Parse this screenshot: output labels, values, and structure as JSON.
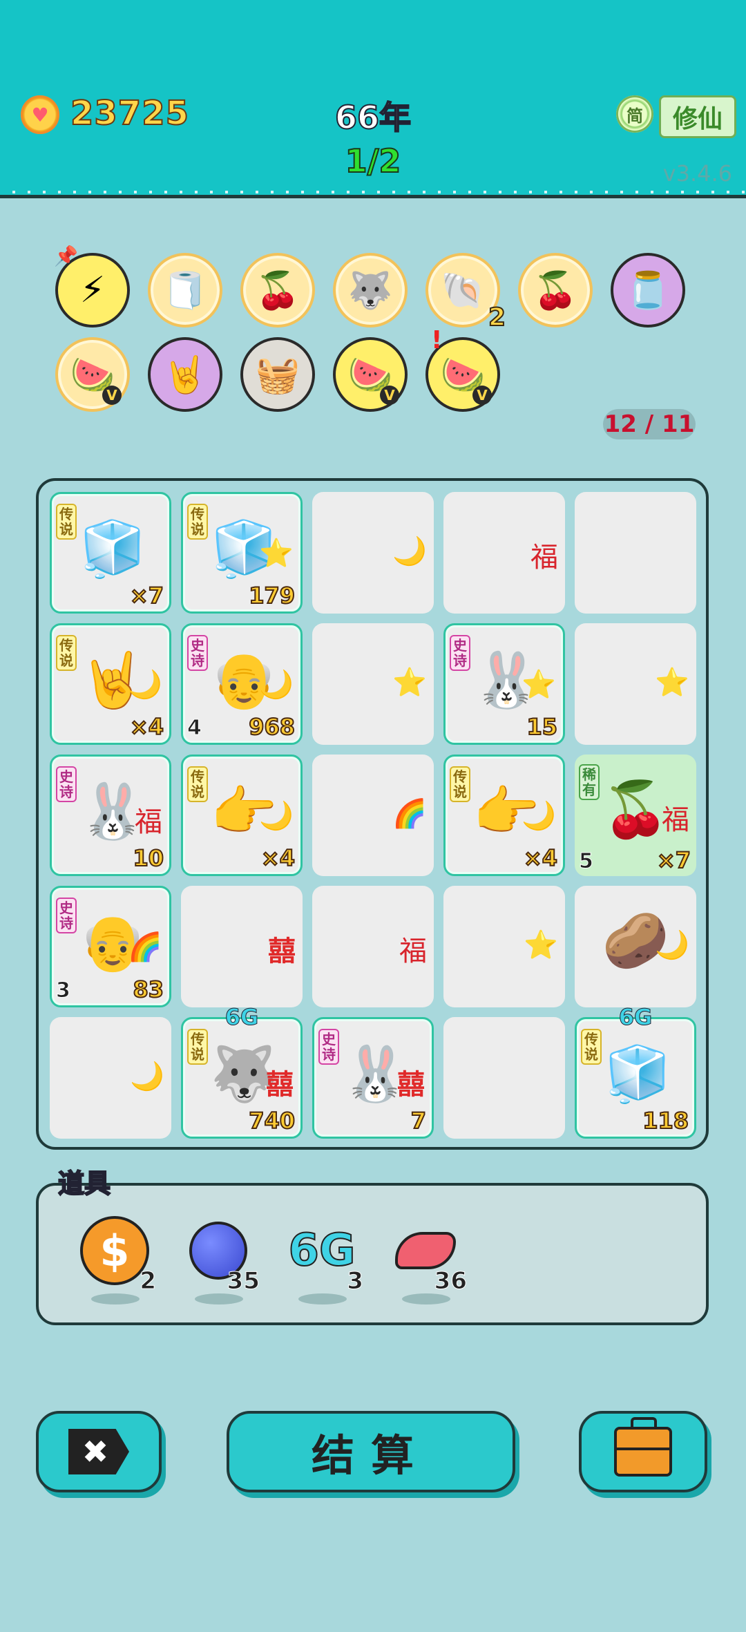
{
  "header": {
    "coins": "23725",
    "coin_icon": "heart-coin-icon",
    "year": "66年",
    "progress": "1/2",
    "mode_badge": "简",
    "mode_button": "修仙",
    "version": "v3.4.6"
  },
  "buffs": {
    "items": [
      {
        "icon": "lightning",
        "glyph": "⚡",
        "count": ""
      },
      {
        "icon": "tissue-box",
        "glyph": "🧻",
        "count": ""
      },
      {
        "icon": "sunglasses-cherries",
        "glyph": "🍒",
        "count": ""
      },
      {
        "icon": "husky",
        "glyph": "🐺",
        "count": ""
      },
      {
        "icon": "seashell",
        "glyph": "🐚",
        "count": "2"
      },
      {
        "icon": "sunglasses-cherries",
        "glyph": "🍒",
        "count": ""
      },
      {
        "icon": "milk-jar",
        "glyph": "🫙",
        "count": ""
      },
      {
        "icon": "fruit-bowl",
        "glyph": "🍉",
        "count": "",
        "v": "V"
      },
      {
        "icon": "rock-hand",
        "glyph": "🤘",
        "count": ""
      },
      {
        "icon": "fruit-basket",
        "glyph": "🧺",
        "count": ""
      },
      {
        "icon": "fruit-bowl",
        "glyph": "🍉",
        "count": "",
        "v": "V"
      },
      {
        "icon": "fruit-bowl",
        "glyph": "🍉",
        "count": "",
        "v": "V",
        "alert": "!"
      }
    ],
    "slots": "12 / 11"
  },
  "board": {
    "cells": [
      {
        "tag": "传说",
        "main": "🧊",
        "side": "",
        "val": "×7",
        "lval": ""
      },
      {
        "tag": "传说",
        "main": "🧊",
        "side": "⭐",
        "val": "179",
        "lval": ""
      },
      {
        "tag": "",
        "main": "",
        "side": "🌙",
        "val": "",
        "lval": ""
      },
      {
        "tag": "",
        "main": "",
        "side": "福",
        "val": "",
        "lval": ""
      },
      {
        "tag": "",
        "main": "",
        "side": "",
        "val": "",
        "lval": ""
      },
      {
        "tag": "传说",
        "main": "🤘",
        "side": "🌙",
        "val": "×4",
        "lval": ""
      },
      {
        "tag": "史诗",
        "main": "👴",
        "side": "🌙",
        "val": "968",
        "lval": "4"
      },
      {
        "tag": "",
        "main": "",
        "side": "⭐",
        "val": "",
        "lval": ""
      },
      {
        "tag": "史诗",
        "main": "🐰",
        "side": "⭐",
        "val": "15",
        "lval": ""
      },
      {
        "tag": "",
        "main": "",
        "side": "⭐",
        "val": "",
        "lval": ""
      },
      {
        "tag": "史诗",
        "main": "🐰",
        "side": "福",
        "val": "10",
        "lval": ""
      },
      {
        "tag": "传说",
        "main": "👉",
        "side": "🌙",
        "val": "×4",
        "lval": ""
      },
      {
        "tag": "",
        "main": "",
        "side": "🌈",
        "val": "",
        "lval": ""
      },
      {
        "tag": "传说",
        "main": "👉",
        "side": "🌙",
        "val": "×4",
        "lval": ""
      },
      {
        "tag": "稀有",
        "main": "🍒",
        "side": "福",
        "val": "×7",
        "lval": "5"
      },
      {
        "tag": "史诗",
        "main": "👴",
        "side": "🌈",
        "val": "83",
        "lval": "3"
      },
      {
        "tag": "",
        "main": "",
        "side": "囍",
        "val": "",
        "lval": ""
      },
      {
        "tag": "",
        "main": "",
        "side": "福",
        "val": "",
        "lval": ""
      },
      {
        "tag": "",
        "main": "",
        "side": "⭐",
        "val": "",
        "lval": ""
      },
      {
        "tag": "",
        "main": "🥔",
        "side": "🌙",
        "val": "",
        "lval": ""
      },
      {
        "tag": "",
        "main": "",
        "side": "🌙",
        "val": "",
        "lval": ""
      },
      {
        "tag": "传说",
        "main": "🐺",
        "side": "囍",
        "val": "740",
        "lval": "",
        "top": "6G"
      },
      {
        "tag": "史诗",
        "main": "🐰",
        "side": "囍",
        "val": "7",
        "lval": ""
      },
      {
        "tag": "",
        "main": "",
        "side": "",
        "val": "",
        "lval": ""
      },
      {
        "tag": "传说",
        "main": "🧊",
        "side": "",
        "val": "118",
        "lval": "",
        "top": "6G"
      }
    ]
  },
  "props": {
    "title": "道具",
    "items": [
      {
        "icon": "dollar-coin",
        "glyph": "$",
        "count": "2"
      },
      {
        "icon": "blueberry",
        "glyph": "🫐",
        "count": "35"
      },
      {
        "icon": "6g-signal",
        "glyph": "6G",
        "count": "3"
      },
      {
        "icon": "liver",
        "glyph": "🫀",
        "count": "36"
      }
    ]
  },
  "buttons": {
    "cancel": "✖",
    "settle": "结算",
    "bag": "briefcase"
  }
}
